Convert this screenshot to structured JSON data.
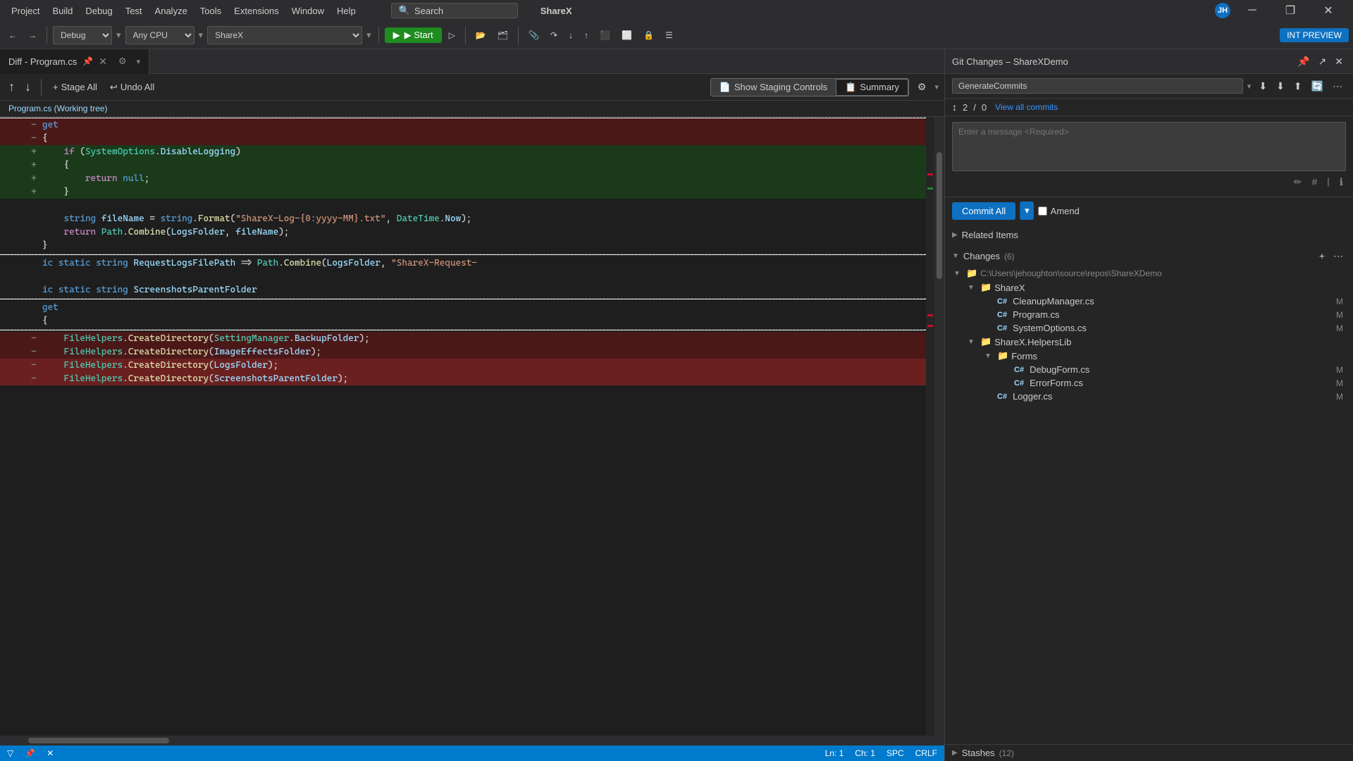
{
  "titlebar": {
    "project": "Project",
    "menu": [
      "Build",
      "Debug",
      "Test",
      "Analyze",
      "Tools",
      "Extensions",
      "Window",
      "Help"
    ],
    "search_label": "Search",
    "app_name": "ShareX",
    "avatar_initials": "JH",
    "win_minimize": "─",
    "win_restore": "❐",
    "win_close": "✕"
  },
  "toolbar": {
    "back_btn": "←",
    "forward_btn": "→",
    "debug_config": "Debug",
    "cpu_config": "Any CPU",
    "project_name": "ShareX",
    "start_label": "▶ Start",
    "int_preview": "INT PREVIEW"
  },
  "diff_panel": {
    "tab_title": "Diff - Program.cs",
    "secondary_bar": {
      "nav_prev": "↑",
      "nav_next": "↓",
      "stage_all": "Stage All",
      "undo_all": "Undo All",
      "show_staging": "Show Staging Controls",
      "summary": "Summary"
    },
    "file_label": "Program.cs (Working tree)",
    "code_lines": [
      {
        "type": "removed",
        "num": "",
        "code": "get"
      },
      {
        "type": "removed",
        "num": "",
        "code": "{"
      },
      {
        "type": "removed",
        "num": "",
        "code": "    if (SystemOptions.DisableLogging)"
      },
      {
        "type": "removed",
        "num": "",
        "code": "    {"
      },
      {
        "type": "removed",
        "num": "",
        "code": "        return null;"
      },
      {
        "type": "removed",
        "num": "",
        "code": "    }"
      },
      {
        "type": "normal",
        "num": "",
        "code": ""
      },
      {
        "type": "normal",
        "num": "",
        "code": "    string fileName = string.Format(\"ShareX-Log-{0:yyyy-MM}.txt\", DateTime.Now);"
      },
      {
        "type": "normal",
        "num": "",
        "code": "    return Path.Combine(LogsFolder, fileName);"
      },
      {
        "type": "normal",
        "num": "",
        "code": "}"
      },
      {
        "type": "normal",
        "num": "",
        "code": ""
      },
      {
        "type": "normal",
        "num": "",
        "code": "ic static string RequestLogsFilePath => Path.Combine(LogsFolder, \"ShareX-Request-"
      },
      {
        "type": "normal",
        "num": "",
        "code": ""
      },
      {
        "type": "normal",
        "num": "",
        "code": "ic static string ScreenshotsParentFolder"
      },
      {
        "type": "normal",
        "num": "",
        "code": ""
      },
      {
        "type": "normal",
        "num": "",
        "code": "get"
      },
      {
        "type": "normal",
        "num": "",
        "code": "{"
      },
      {
        "type": "removed",
        "num": "",
        "code": "    FileHelpers.CreateDirectory(SettingManager.BackupFolder);"
      },
      {
        "type": "removed",
        "num": "",
        "code": "    FileHelpers.CreateDirectory(ImageEffectsFolder);"
      },
      {
        "type": "removed-dark",
        "num": "",
        "code": "    FileHelpers.CreateDirectory(LogsFolder);"
      },
      {
        "type": "removed-dark",
        "num": "",
        "code": "    FileHelpers.CreateDirectory(ScreenshotsParentFolder);"
      }
    ],
    "status_bar": {
      "ln": "Ln: 1",
      "ch": "Ch: 1",
      "spc": "SPC",
      "crlf": "CRLF"
    }
  },
  "git_panel": {
    "title": "Git Changes – ShareXDemo",
    "branch": "GenerateCommits",
    "commits_up": "2",
    "commits_down": "0",
    "view_all_commits": "View all commits",
    "message_placeholder": "Enter a message <Required>",
    "commit_all_label": "Commit All",
    "amend_label": "Amend",
    "related_items": "Related Items",
    "changes_label": "Changes",
    "changes_count": "(6)",
    "repo_path": "C:\\Users\\jehoughton\\source\\repos\\ShareXDemo",
    "sharex_folder": "ShareX",
    "files": [
      {
        "name": "CleanupManager.cs",
        "status": "M"
      },
      {
        "name": "Program.cs",
        "status": "M"
      },
      {
        "name": "SystemOptions.cs",
        "status": "M"
      }
    ],
    "helpers_lib": "ShareX.HelpersLib",
    "forms_folder": "Forms",
    "lib_files": [
      {
        "name": "DebugForm.cs",
        "status": "M"
      },
      {
        "name": "ErrorForm.cs",
        "status": "M"
      },
      {
        "name": "Logger.cs",
        "status": "M"
      }
    ],
    "stashes_label": "Stashes",
    "stashes_count": "(12)"
  }
}
